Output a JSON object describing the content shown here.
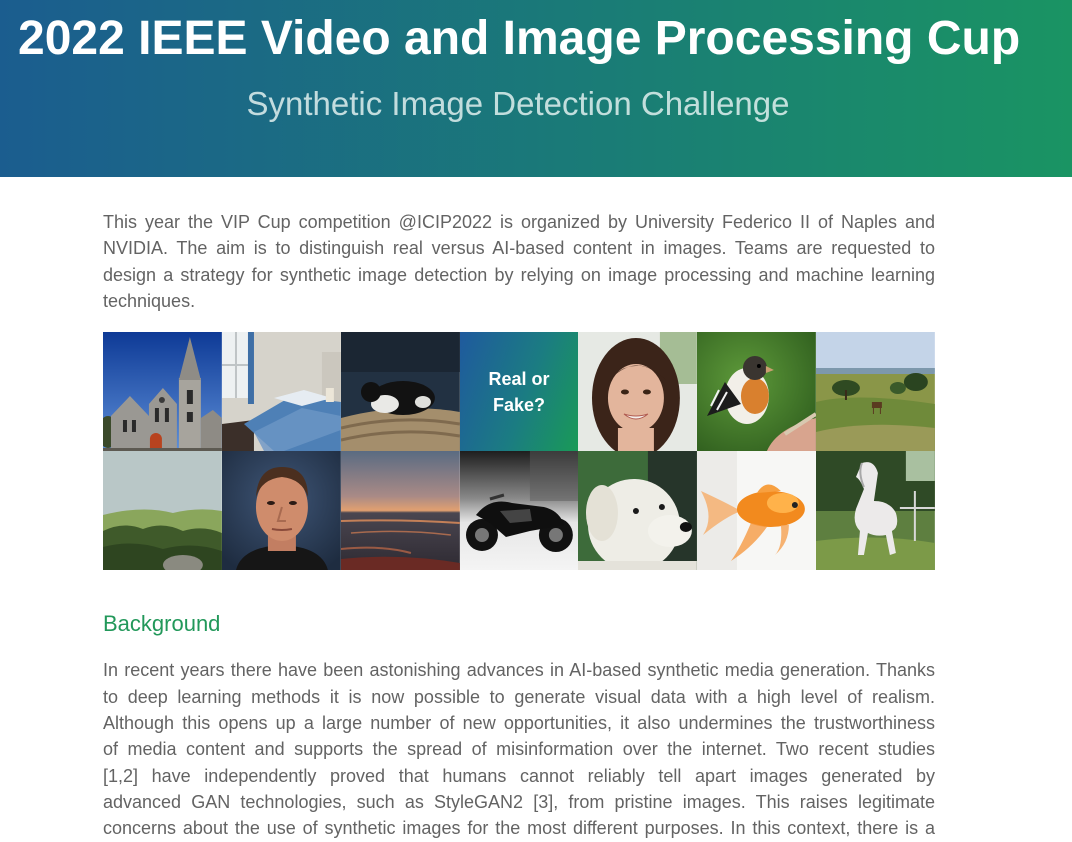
{
  "header": {
    "title": "2022 IEEE Video and Image Processing Cup",
    "subtitle": "Synthetic Image Detection Challenge"
  },
  "intro": {
    "lines": [
      "This year the VIP Cup competition @ICIP2022 is organized by University Federico II of Naples and",
      "NVIDIA. The aim is to distinguish real versus AI-based content in images. Teams are requested to",
      "design a strategy for synthetic image detection by relying on image processing and machine learning",
      "techniques."
    ]
  },
  "gallery": {
    "overlay_text": "Real or Fake?"
  },
  "background": {
    "heading": "Background",
    "lines": [
      "In recent years there have been astonishing advances in AI-based synthetic media generation. Thanks",
      "to deep learning methods it is now possible to generate visual data with a high level of realism.",
      "Although this opens up a large number of new opportunities, it also undermines the trustworthiness",
      "of media content and supports the spread of misinformation over the internet. Two recent studies",
      "[1,2] have independently proved that humans cannot reliably tell apart images generated by",
      "advanced GAN technologies, such as StyleGAN2 [3], from pristine images. This raises legitimate",
      "concerns about the use of synthetic images for the most different purposes. In this context, there is a"
    ]
  },
  "colors": {
    "header_gradient_start": "#1b5d8f",
    "header_gradient_end": "#1a9463",
    "heading_green": "#22985a",
    "body_text": "#636363",
    "title_text": "#ffffff"
  }
}
